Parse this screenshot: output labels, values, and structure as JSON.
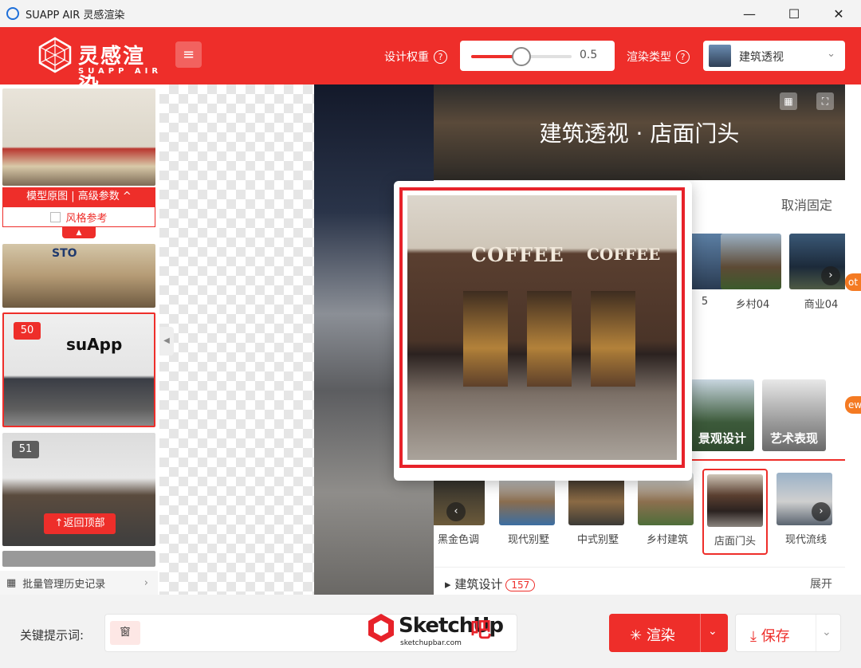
{
  "window": {
    "title": "SUAPP AIR 灵感渲染",
    "minimize": "—",
    "maximize": "☐",
    "close": "✕"
  },
  "brand": {
    "name_cn": "灵感渲染",
    "name_en": "SUAPP AIR"
  },
  "header": {
    "weight_label": "设计权重",
    "weight_value": "0.5",
    "weight_fraction": 0.5,
    "type_label": "渲染类型",
    "type_value": "建筑透视"
  },
  "sidebar": {
    "adv_bar": "模型原图 | 高级参数 ^",
    "style_ref": "风格参考",
    "thumb1_sign": "STO",
    "thumb2_sign": "suApp",
    "badge_50": "50",
    "badge_51": "51",
    "back_top": "↑返回顶部",
    "history": "批量管理历史记录"
  },
  "panel": {
    "hero_title": "建筑透视 · 店面门头",
    "unpin": "取消固定",
    "strip": [
      {
        "label": "5"
      },
      {
        "label": "乡村04"
      },
      {
        "label": "商业04"
      }
    ],
    "categories": [
      {
        "label": "景观设计"
      },
      {
        "label": "艺术表现"
      }
    ],
    "sub_items": [
      {
        "label": "黑金色调"
      },
      {
        "label": "现代别墅"
      },
      {
        "label": "中式别墅"
      },
      {
        "label": "乡村建筑"
      },
      {
        "label": "店面门头"
      },
      {
        "label": "现代流线"
      }
    ],
    "arch_label": "建筑设计",
    "arch_count": "157",
    "expand": "展开",
    "tag_hot": "ot",
    "tag_new": "ew"
  },
  "popup": {
    "sign1": "COFFEE",
    "sign2": "COFFEE"
  },
  "bottom": {
    "keyword_label": "关键提示词:",
    "keyword_chip": "窗",
    "watermark": "SketchUp",
    "watermark_accent": "吧",
    "watermark_url": "sketchupbar.com",
    "render": "渲染",
    "save": "保存"
  }
}
